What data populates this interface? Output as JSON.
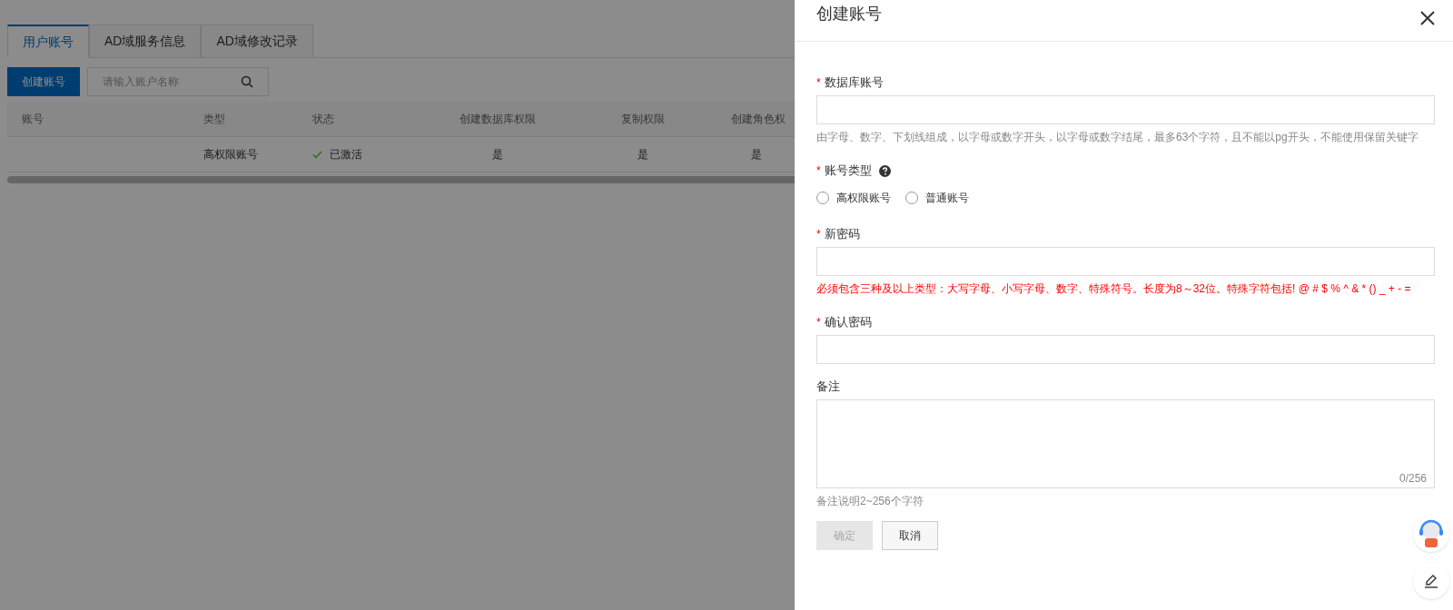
{
  "tabs": [
    {
      "label": "用户账号",
      "selected": true
    },
    {
      "label": "AD域服务信息",
      "selected": false
    },
    {
      "label": "AD域修改记录",
      "selected": false
    }
  ],
  "create_button": "创建账号",
  "search": {
    "placeholder": "请输入账户名称"
  },
  "table": {
    "columns": [
      "账号",
      "类型",
      "状态",
      "创建数据库权限",
      "复制权限",
      "创建角色权"
    ],
    "rows": [
      {
        "type": "高权限账号",
        "status": "已激活",
        "status_ok": true,
        "create_db": "是",
        "replicate": "是",
        "create_role": "是"
      }
    ]
  },
  "drawer": {
    "title": "创建账号",
    "fields": [
      {
        "kind": "text",
        "label": "数据库账号",
        "required_mark": "*",
        "hint": "由字母、数字、下划线组成，以字母或数字开头，以字母或数字结尾，最多63个字符，且不能以pg开头，不能使用保留关键字",
        "hint_error": false
      },
      {
        "kind": "radio",
        "label": "账号类型",
        "required_mark": "*",
        "help_icon": true,
        "options": [
          {
            "label": "高权限账号",
            "selected": false
          },
          {
            "label": "普通账号",
            "selected": false
          }
        ]
      },
      {
        "kind": "password",
        "label": "新密码",
        "required_mark": "*",
        "hint": "必须包含三种及以上类型：大写字母、小写字母、数字、特殊符号。长度为8～32位。特殊字符包括! @ # $ % ^ & * () _ + - =",
        "hint_error": true
      },
      {
        "kind": "password",
        "label": "确认密码",
        "required_mark": "*"
      },
      {
        "kind": "textarea",
        "label": "备注",
        "counter": "0/256",
        "hint": "备注说明2~256个字符",
        "hint_error": false
      }
    ],
    "buttons": [
      {
        "label": "确定",
        "disabled": true
      },
      {
        "label": "取消",
        "disabled": false
      }
    ]
  }
}
